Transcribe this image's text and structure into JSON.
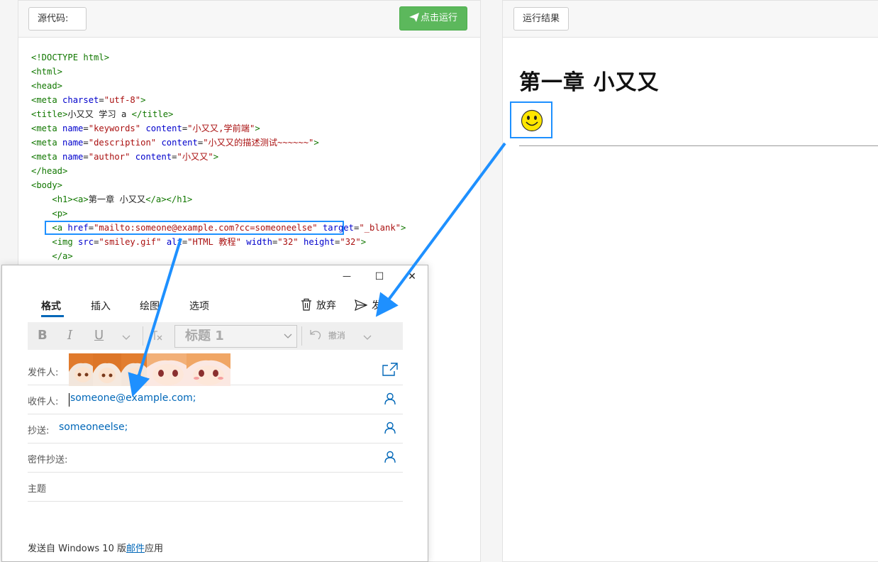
{
  "left_panel": {
    "source_label": "源代码:",
    "run_button": "点击运行"
  },
  "code_lines": [
    [
      {
        "c": "tg",
        "t": "<!DOCTYPE html>"
      }
    ],
    [
      {
        "c": "tg",
        "t": "<html>"
      }
    ],
    [
      {
        "c": "tg",
        "t": "<head>"
      }
    ],
    [
      {
        "c": "tg",
        "t": "<meta "
      },
      {
        "c": "at",
        "t": "charset"
      },
      {
        "c": "tx",
        "t": "="
      },
      {
        "c": "st",
        "t": "\"utf-8\""
      },
      {
        "c": "tg",
        "t": ">"
      }
    ],
    [
      {
        "c": "tg",
        "t": "<title>"
      },
      {
        "c": "tx",
        "t": "小又又 学习 a "
      },
      {
        "c": "tg",
        "t": "</title>"
      }
    ],
    [
      {
        "c": "tg",
        "t": "<meta "
      },
      {
        "c": "at",
        "t": "name"
      },
      {
        "c": "tx",
        "t": "="
      },
      {
        "c": "st",
        "t": "\"keywords\""
      },
      {
        "c": "tx",
        "t": " "
      },
      {
        "c": "at",
        "t": "content"
      },
      {
        "c": "tx",
        "t": "="
      },
      {
        "c": "st",
        "t": "\"小又又,学前端\""
      },
      {
        "c": "tg",
        "t": ">"
      }
    ],
    [
      {
        "c": "tg",
        "t": "<meta "
      },
      {
        "c": "at",
        "t": "name"
      },
      {
        "c": "tx",
        "t": "="
      },
      {
        "c": "st",
        "t": "\"description\""
      },
      {
        "c": "tx",
        "t": " "
      },
      {
        "c": "at",
        "t": "content"
      },
      {
        "c": "tx",
        "t": "="
      },
      {
        "c": "st",
        "t": "\"小又又的描述测试~~~~~~\""
      },
      {
        "c": "tg",
        "t": ">"
      }
    ],
    [
      {
        "c": "tg",
        "t": "<meta "
      },
      {
        "c": "at",
        "t": "name"
      },
      {
        "c": "tx",
        "t": "="
      },
      {
        "c": "st",
        "t": "\"author\""
      },
      {
        "c": "tx",
        "t": " "
      },
      {
        "c": "at",
        "t": "content"
      },
      {
        "c": "tx",
        "t": "="
      },
      {
        "c": "st",
        "t": "\"小又又\""
      },
      {
        "c": "tg",
        "t": ">"
      }
    ],
    [
      {
        "c": "tg",
        "t": "</head>"
      }
    ],
    [
      {
        "c": "tg",
        "t": "<body>"
      }
    ],
    [
      {
        "c": "tx",
        "t": "    "
      },
      {
        "c": "tg",
        "t": "<h1><a>"
      },
      {
        "c": "tx",
        "t": "第一章 小又又"
      },
      {
        "c": "tg",
        "t": "</a></h1>"
      }
    ],
    [
      {
        "c": "tx",
        "t": "    "
      },
      {
        "c": "tg",
        "t": "<p>"
      }
    ],
    [
      {
        "c": "tx",
        "t": "    "
      },
      {
        "c": "tg",
        "t": "<a "
      },
      {
        "c": "at",
        "t": "href"
      },
      {
        "c": "tx",
        "t": "="
      },
      {
        "c": "st",
        "t": "\"mailto:someone@example.com?cc=someoneelse\""
      },
      {
        "c": "tx",
        "t": " "
      },
      {
        "c": "at",
        "t": "target"
      },
      {
        "c": "tx",
        "t": "="
      },
      {
        "c": "st",
        "t": "\"_blank\""
      },
      {
        "c": "tg",
        "t": ">"
      }
    ],
    [
      {
        "c": "tx",
        "t": "    "
      },
      {
        "c": "tg",
        "t": "<img "
      },
      {
        "c": "at",
        "t": "src"
      },
      {
        "c": "tx",
        "t": "="
      },
      {
        "c": "st",
        "t": "\"smiley.gif\""
      },
      {
        "c": "tx",
        "t": " "
      },
      {
        "c": "at",
        "t": "alt"
      },
      {
        "c": "tx",
        "t": "="
      },
      {
        "c": "st",
        "t": "\"HTML 教程\""
      },
      {
        "c": "tx",
        "t": " "
      },
      {
        "c": "at",
        "t": "width"
      },
      {
        "c": "tx",
        "t": "="
      },
      {
        "c": "st",
        "t": "\"32\""
      },
      {
        "c": "tx",
        "t": " "
      },
      {
        "c": "at",
        "t": "height"
      },
      {
        "c": "tx",
        "t": "="
      },
      {
        "c": "st",
        "t": "\"32\""
      },
      {
        "c": "tg",
        "t": ">"
      }
    ],
    [
      {
        "c": "tx",
        "t": "    "
      },
      {
        "c": "tg",
        "t": "</a>"
      }
    ]
  ],
  "right_panel": {
    "result_label": "运行结果",
    "heading": "第一章 小又又"
  },
  "mail": {
    "window_controls": {
      "minimize": "—",
      "maximize": "☐",
      "close": "✕"
    },
    "tabs": [
      "格式",
      "插入",
      "绘图",
      "选项"
    ],
    "discard": "放弃",
    "send": "发送",
    "toolbar": {
      "bold": "B",
      "italic": "I",
      "underline": "U",
      "heading": "标题 1",
      "undo": "撤消"
    },
    "from_label": "发件人:",
    "to_label": "收件人:",
    "to_value": "someone@example.com;",
    "cc_label": "抄送:",
    "cc_value": "someoneelse;",
    "bcc_label": "密件抄送:",
    "subject_label": "主题",
    "footer_prefix": "发送自 Windows 10 版",
    "footer_link": "邮件",
    "footer_suffix": "应用"
  },
  "colors": {
    "run_button": "#5cb85c",
    "highlight": "#1e90ff",
    "mail_accent": "#0067b8"
  },
  "icons": [
    "paper-plane-icon",
    "trash-icon",
    "send-icon",
    "person-icon",
    "popout-icon",
    "undo-icon",
    "chevron-down-icon",
    "smiley-icon"
  ]
}
